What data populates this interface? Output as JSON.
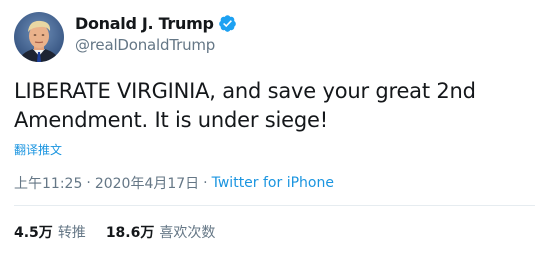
{
  "author": {
    "display_name": "Donald J. Trump",
    "handle": "@realDonaldTrump",
    "verified": true,
    "avatar_icon": "profile-photo",
    "verified_icon": "verified-badge-icon",
    "verified_color": "#1da1f2"
  },
  "tweet": {
    "text": "LIBERATE VIRGINIA, and save your great 2nd Amendment. It is under siege!",
    "translate_label": "翻译推文"
  },
  "meta": {
    "time": "上午11:25",
    "separator_1": "·",
    "date": "2020年4月17日",
    "separator_2": "·",
    "source": "Twitter for iPhone"
  },
  "stats": {
    "retweets_count": "4.5万",
    "retweets_label": "转推",
    "likes_count": "18.6万",
    "likes_label": "喜欢次数"
  },
  "colors": {
    "link": "#1b95e0",
    "secondary_text": "#657786",
    "primary_text": "#14171a",
    "divider": "#e6ecf0"
  }
}
